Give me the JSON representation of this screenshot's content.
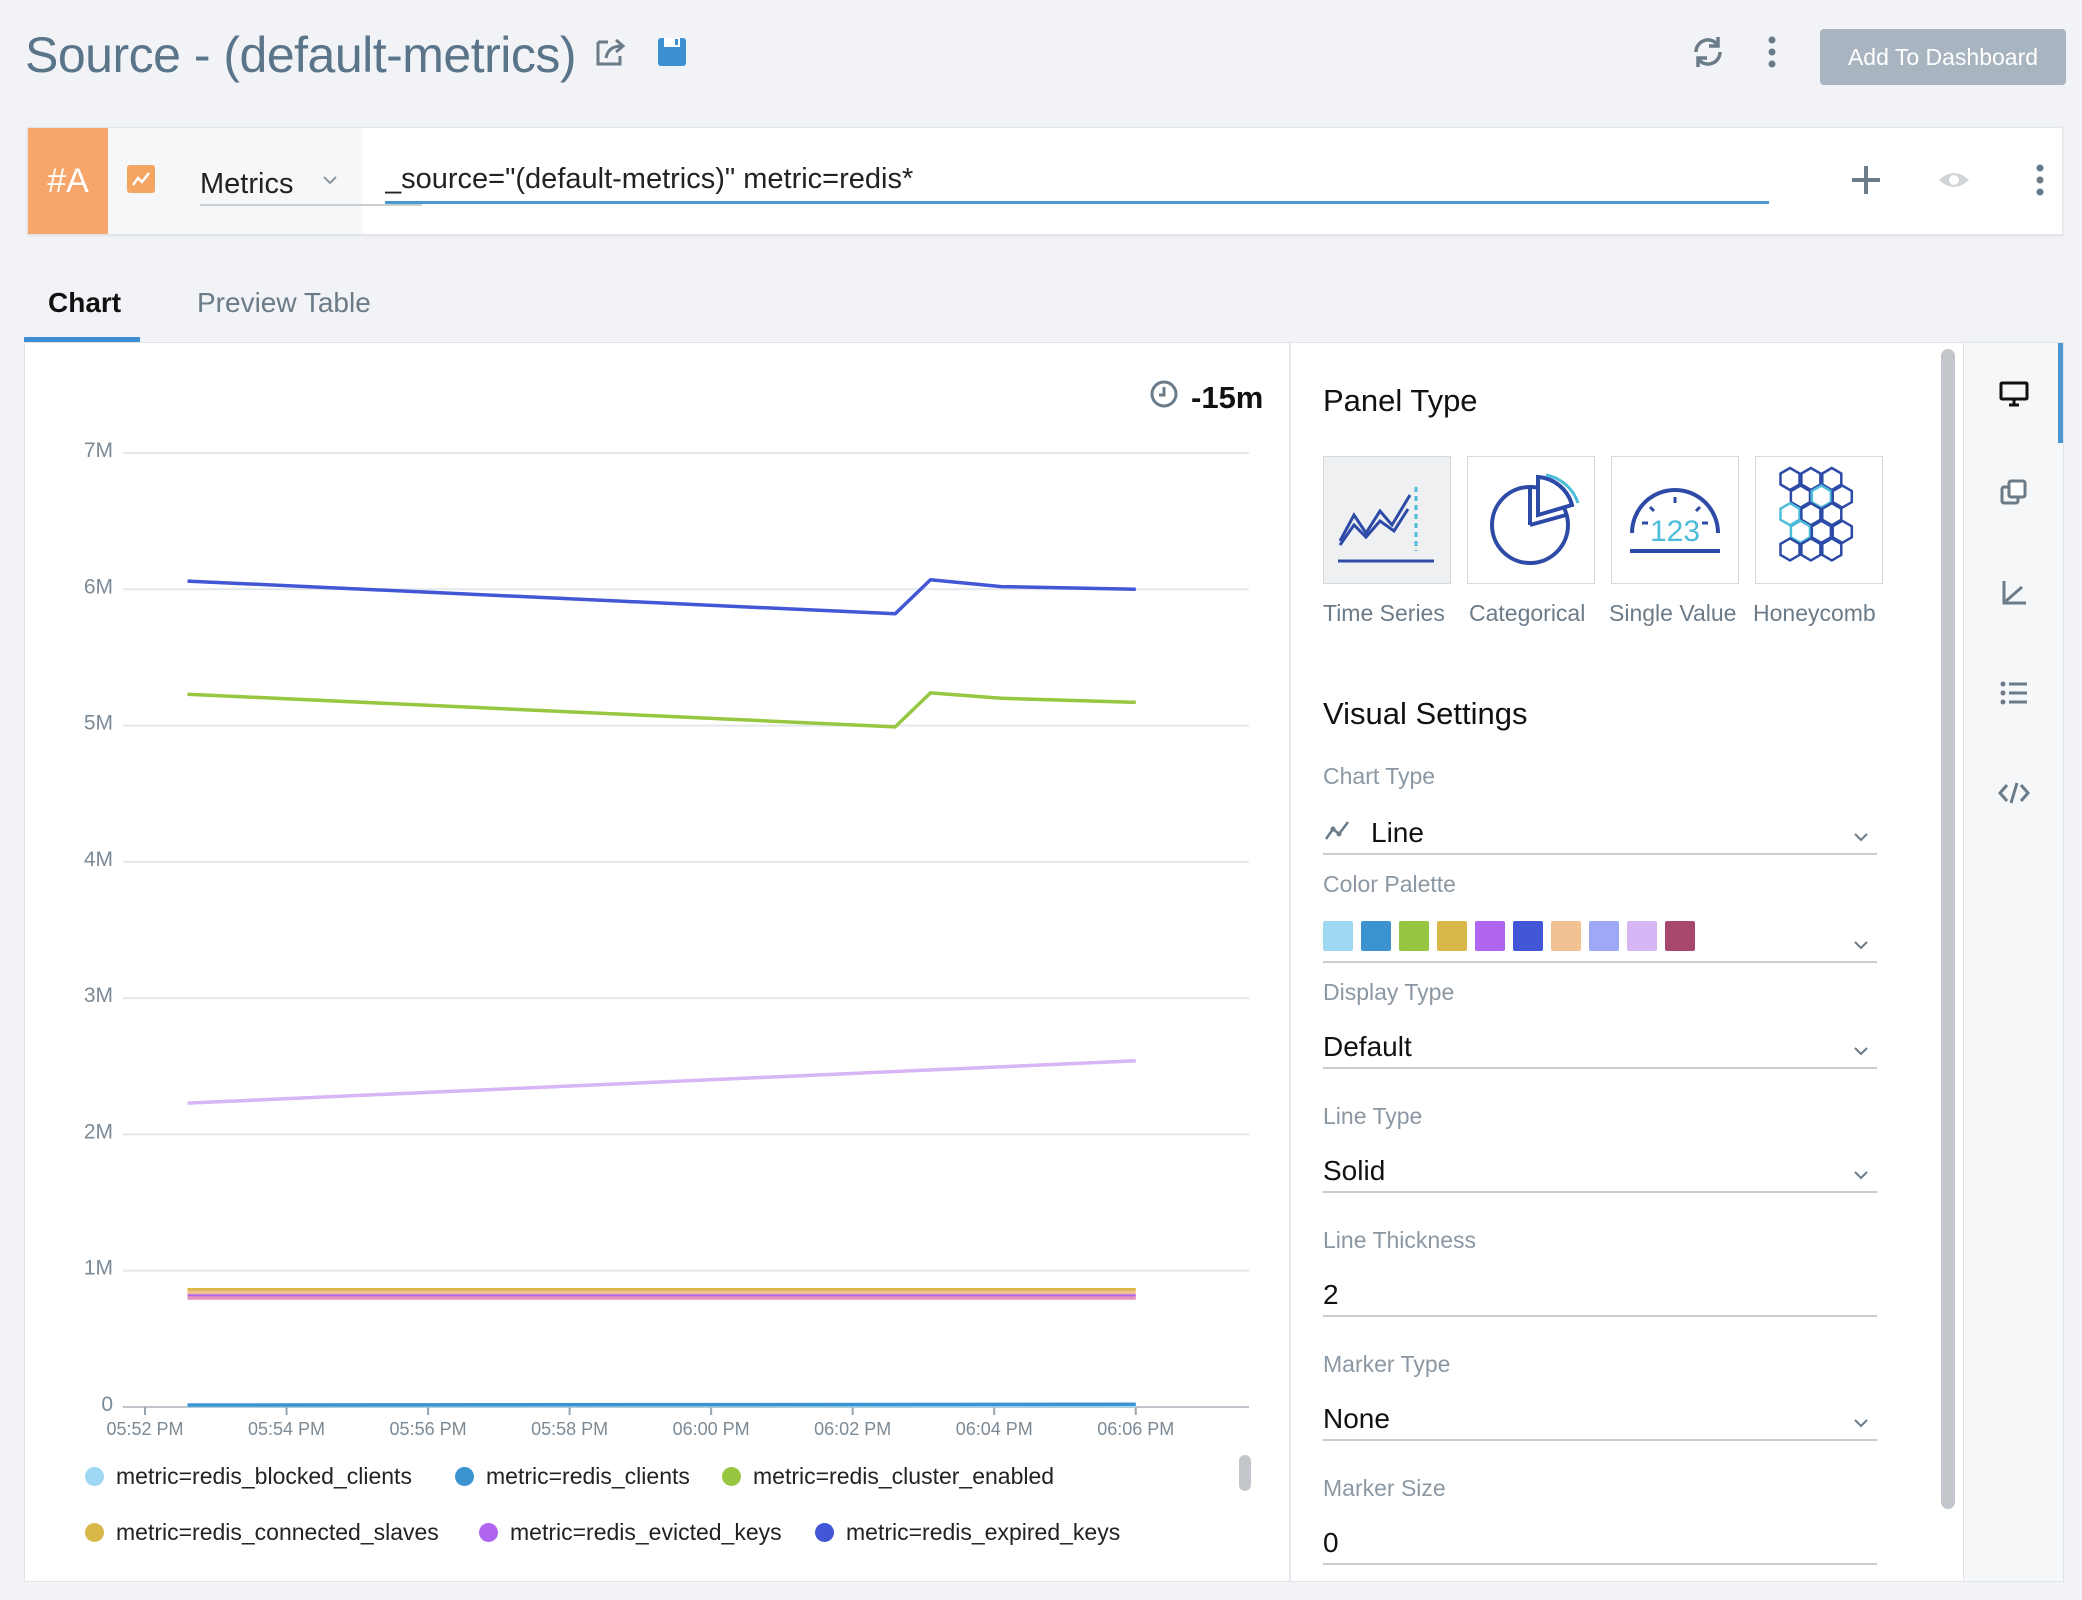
{
  "header": {
    "title": "Source - (default-metrics)",
    "add_button": "Add To Dashboard"
  },
  "query": {
    "letter": "#A",
    "type_label": "Metrics",
    "text": "_source=\"(default-metrics)\" metric=redis*"
  },
  "tabs": [
    {
      "label": "Chart",
      "active": true
    },
    {
      "label": "Preview Table",
      "active": false
    }
  ],
  "chart_data": {
    "type": "line",
    "time_range": "-15m",
    "x": [
      "05:52 PM",
      "05:54 PM",
      "05:56 PM",
      "05:58 PM",
      "06:00 PM",
      "06:02 PM",
      "06:04 PM",
      "06:06 PM"
    ],
    "x_ticks_minutes": [
      0,
      2,
      4,
      6,
      8,
      10,
      12,
      14
    ],
    "y_ticks": [
      "0",
      "1M",
      "2M",
      "3M",
      "4M",
      "5M",
      "6M",
      "7M"
    ],
    "ylim": [
      0,
      7000000
    ],
    "grid": true,
    "series": [
      {
        "name": "metric=redis_blocked_clients",
        "color": "#9fd8f3",
        "x_minutes": [
          0.6,
          14
        ],
        "values": [
          10000,
          10000
        ]
      },
      {
        "name": "metric=redis_clients",
        "color": "#3b94d1",
        "x_minutes": [
          0.6,
          14
        ],
        "values": [
          15000,
          20000
        ]
      },
      {
        "name": "metric=redis_cluster_enabled",
        "color": "#97c740",
        "x_minutes": [
          0.6,
          10.6,
          11.1,
          12.1,
          14
        ],
        "values": [
          5230000,
          4990000,
          5240000,
          5200000,
          5170000
        ]
      },
      {
        "name": "metric=redis_connected_slaves",
        "color": "#d9b84a",
        "x_minutes": [
          0.6,
          14
        ],
        "values": [
          860000,
          860000
        ]
      },
      {
        "name": "metric=redis_evicted_keys",
        "color": "#b065f0",
        "x_minutes": [
          0.6,
          14
        ],
        "values": [
          820000,
          820000
        ]
      },
      {
        "name": "metric=redis_expired_keys",
        "color": "#4257d6",
        "x_minutes": [
          0.6,
          10.6,
          11.1,
          12.1,
          14
        ],
        "values": [
          6060000,
          5820000,
          6070000,
          6020000,
          6000000
        ]
      },
      {
        "color": "#f2c293",
        "x_minutes": [
          0.6,
          14
        ],
        "values": [
          840000,
          840000
        ]
      },
      {
        "color": "#e394b8",
        "x_minutes": [
          0.6,
          14
        ],
        "values": [
          800000,
          800000
        ]
      },
      {
        "color": "#d6b6f4",
        "x_minutes": [
          0.6,
          14
        ],
        "values": [
          2230000,
          2540000
        ]
      }
    ]
  },
  "settings": {
    "panel_type_title": "Panel Type",
    "panel_types": [
      "Time Series",
      "Categorical",
      "Single Value",
      "Honeycomb"
    ],
    "selected_panel_type": "Time Series",
    "single_value_glyph": "123",
    "visual_title": "Visual Settings",
    "chart_type_label": "Chart Type",
    "chart_type_value": "Line",
    "color_palette_label": "Color Palette",
    "palette": [
      "#9fd8f3",
      "#3b94d1",
      "#97c740",
      "#d9b84a",
      "#b065f0",
      "#4257d6",
      "#f2c293",
      "#9fa8f5",
      "#d6b6f4",
      "#a8466e"
    ],
    "display_type_label": "Display Type",
    "display_type_value": "Default",
    "line_type_label": "Line Type",
    "line_type_value": "Solid",
    "line_thickness_label": "Line Thickness",
    "line_thickness_value": "2",
    "marker_type_label": "Marker Type",
    "marker_type_value": "None",
    "marker_size_label": "Marker Size",
    "marker_size_value": "0"
  }
}
